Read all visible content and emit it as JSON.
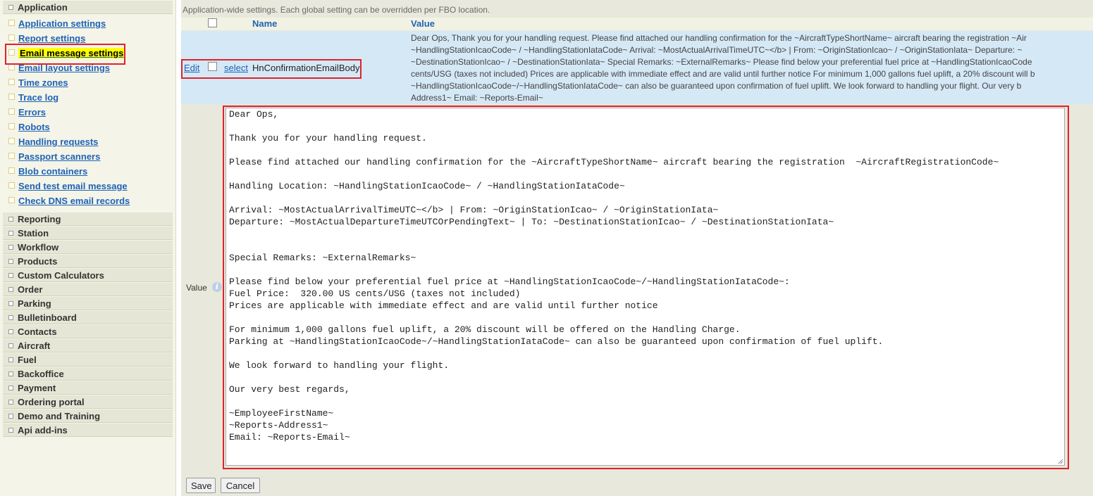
{
  "sidebar": {
    "application_header": "Application",
    "items": [
      {
        "label": "Application settings"
      },
      {
        "label": "Report settings"
      },
      {
        "label": "Email message settings",
        "active": true
      },
      {
        "label": "Email layout settings"
      },
      {
        "label": "Time zones"
      },
      {
        "label": "Trace log"
      },
      {
        "label": "Errors"
      },
      {
        "label": "Robots"
      },
      {
        "label": "Handling requests"
      },
      {
        "label": "Passport scanners"
      },
      {
        "label": "Blob containers"
      },
      {
        "label": "Send test email message"
      },
      {
        "label": "Check DNS email records"
      }
    ],
    "sections": [
      "Reporting",
      "Station",
      "Workflow",
      "Products",
      "Custom Calculators",
      "Order",
      "Parking",
      "Bulletinboard",
      "Contacts",
      "Aircraft",
      "Fuel",
      "Backoffice",
      "Payment",
      "Ordering portal",
      "Demo and Training",
      "Api add-ins"
    ]
  },
  "main": {
    "intro": "Application-wide settings. Each global setting can be overridden per FBO location.",
    "columns": {
      "name": "Name",
      "value": "Value"
    },
    "row": {
      "edit_link": "Edit",
      "select_link": "select",
      "name": "HnConfirmationEmailBody",
      "preview_lines": [
        "Dear Ops, Thank you for your handling request. Please find attached our handling confirmation for the ~AircraftTypeShortName~ aircraft bearing the registration ~Air",
        "~HandlingStationIcaoCode~ / ~HandlingStationIataCode~ Arrival: ~MostActualArrivalTimeUTC~</b> | From: ~OriginStationIcao~ / ~OriginStationIata~ Departure: ~",
        "~DestinationStationIcao~ / ~DestinationStationIata~ Special Remarks: ~ExternalRemarks~ Please find below your preferential fuel price at ~HandlingStationIcaoCode",
        "cents/USG (taxes not included) Prices are applicable with immediate effect and are valid until further notice For minimum 1,000 gallons fuel uplift, a 20% discount will b",
        "~HandlingStationIcaoCode~/~HandlingStationIataCode~ can also be guaranteed upon confirmation of fuel uplift. We look forward to handling your flight. Our very b",
        "Address1~ Email: ~Reports-Email~"
      ]
    },
    "value_label": "Value",
    "editor_lines": [
      "Dear Ops,",
      "",
      "Thank you for your handling request.",
      "",
      "Please find attached our handling confirmation for the ~AircraftTypeShortName~ aircraft bearing the registration  ~AircraftRegistrationCode~",
      "",
      "Handling Location: ~HandlingStationIcaoCode~ / ~HandlingStationIataCode~",
      "",
      "Arrival: ~MostActualArrivalTimeUTC~</b> | From: ~OriginStationIcao~ / ~OriginStationIata~",
      "Departure: ~MostActualDepartureTimeUTCOrPendingText~ | To: ~DestinationStationIcao~ / ~DestinationStationIata~",
      "",
      "",
      "Special Remarks: ~ExternalRemarks~",
      "",
      "Please find below your preferential fuel price at ~HandlingStationIcaoCode~/~HandlingStationIataCode~:",
      "Fuel Price:  320.00 US cents/USG (taxes not included)",
      "Prices are applicable with immediate effect and are valid until further notice",
      "",
      "For minimum 1,000 gallons fuel uplift, a 20% discount will be offered on the Handling Charge.",
      "Parking at ~HandlingStationIcaoCode~/~HandlingStationIataCode~ can also be guaranteed upon confirmation of fuel uplift.",
      "",
      "We look forward to handling your flight.",
      "",
      "Our very best regards,",
      "",
      "~EmployeeFirstName~",
      "~Reports-Address1~",
      "Email: ~Reports-Email~"
    ],
    "save_label": "Save",
    "cancel_label": "Cancel"
  }
}
